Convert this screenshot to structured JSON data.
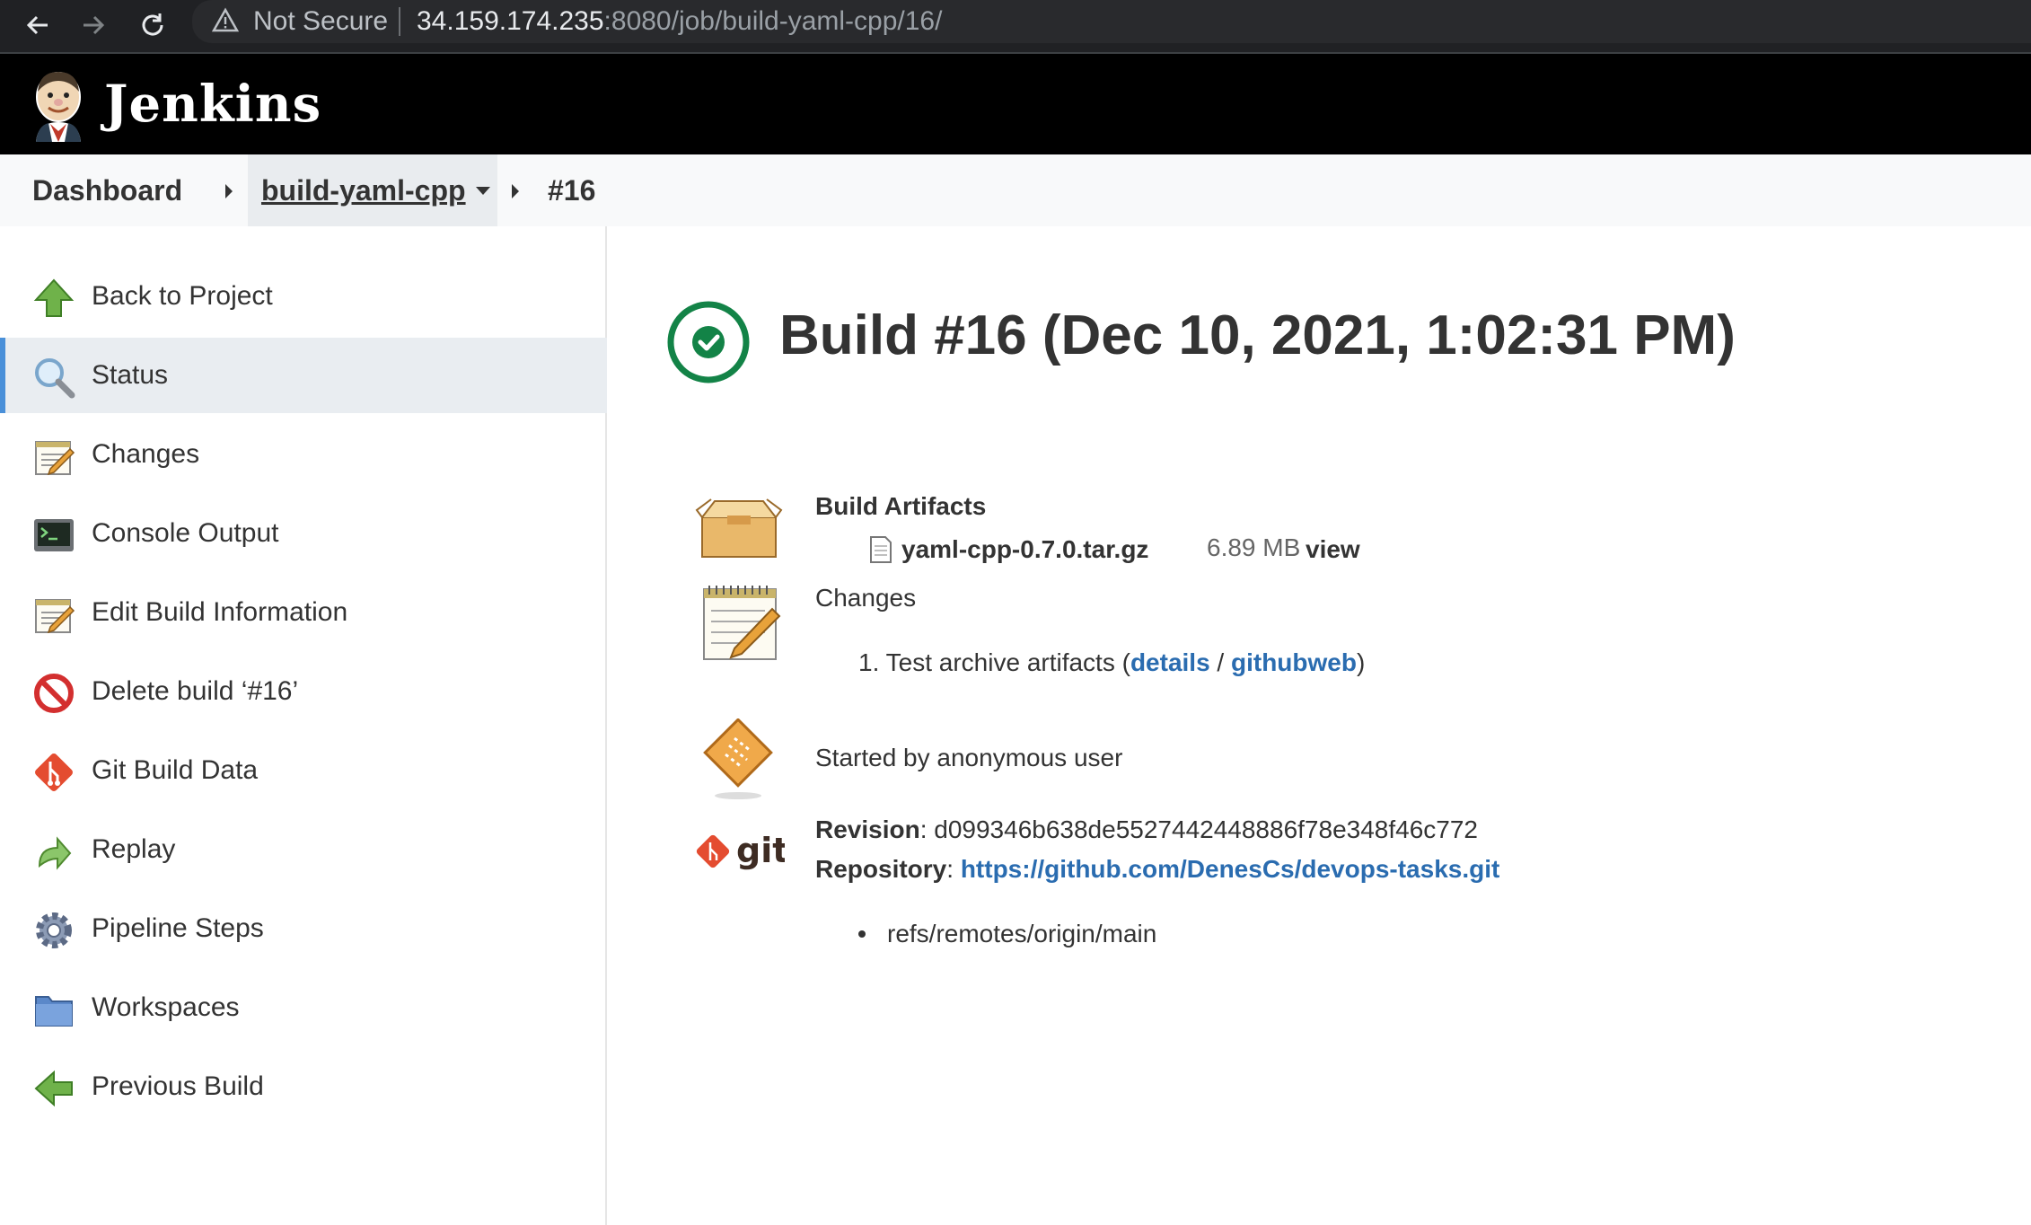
{
  "browser": {
    "security_label": "Not Secure",
    "url_host": "34.159.174.235",
    "url_rest": ":8080/job/build-yaml-cpp/16/"
  },
  "header": {
    "title": "Jenkins"
  },
  "breadcrumb": {
    "dashboard": "Dashboard",
    "job": "build-yaml-cpp",
    "build": "#16"
  },
  "sidebar": {
    "items": [
      {
        "label": "Back to Project",
        "icon": "up-arrow-icon"
      },
      {
        "label": "Status",
        "icon": "magnifier-icon",
        "active": true
      },
      {
        "label": "Changes",
        "icon": "notepad-icon"
      },
      {
        "label": "Console Output",
        "icon": "terminal-icon"
      },
      {
        "label": "Edit Build Information",
        "icon": "notepad-icon"
      },
      {
        "label": "Delete build ‘#16’",
        "icon": "no-entry-icon"
      },
      {
        "label": "Git Build Data",
        "icon": "git-icon"
      },
      {
        "label": "Replay",
        "icon": "replay-arrow-icon"
      },
      {
        "label": "Pipeline Steps",
        "icon": "gear-icon"
      },
      {
        "label": "Workspaces",
        "icon": "folder-icon"
      },
      {
        "label": "Previous Build",
        "icon": "left-arrow-icon"
      }
    ]
  },
  "main": {
    "title": "Build #16 (Dec 10, 2021, 1:02:31 PM)",
    "status": "success",
    "artifacts": {
      "heading": "Build Artifacts",
      "files": [
        {
          "name": "yaml-cpp-0.7.0.tar.gz",
          "size": "6.89 MB",
          "view": "view"
        }
      ]
    },
    "changes": {
      "heading": "Changes",
      "items": [
        {
          "num": "1.",
          "text": "Test archive artifacts (",
          "details": "details",
          "sep": " / ",
          "githubweb": "githubweb",
          "close": ")"
        }
      ]
    },
    "cause": "Started by anonymous user",
    "git": {
      "revision_label": "Revision",
      "revision": "d099346b638de5527442448886f78e348f46c772",
      "repository_label": "Repository",
      "repository": "https://github.com/DenesCs/devops-tasks.git",
      "branches": [
        "refs/remotes/origin/main"
      ]
    }
  },
  "colors": {
    "link": "#2a6cb0",
    "success": "#138347",
    "header_bg": "#000000",
    "active_indicator": "#4a90d9"
  }
}
